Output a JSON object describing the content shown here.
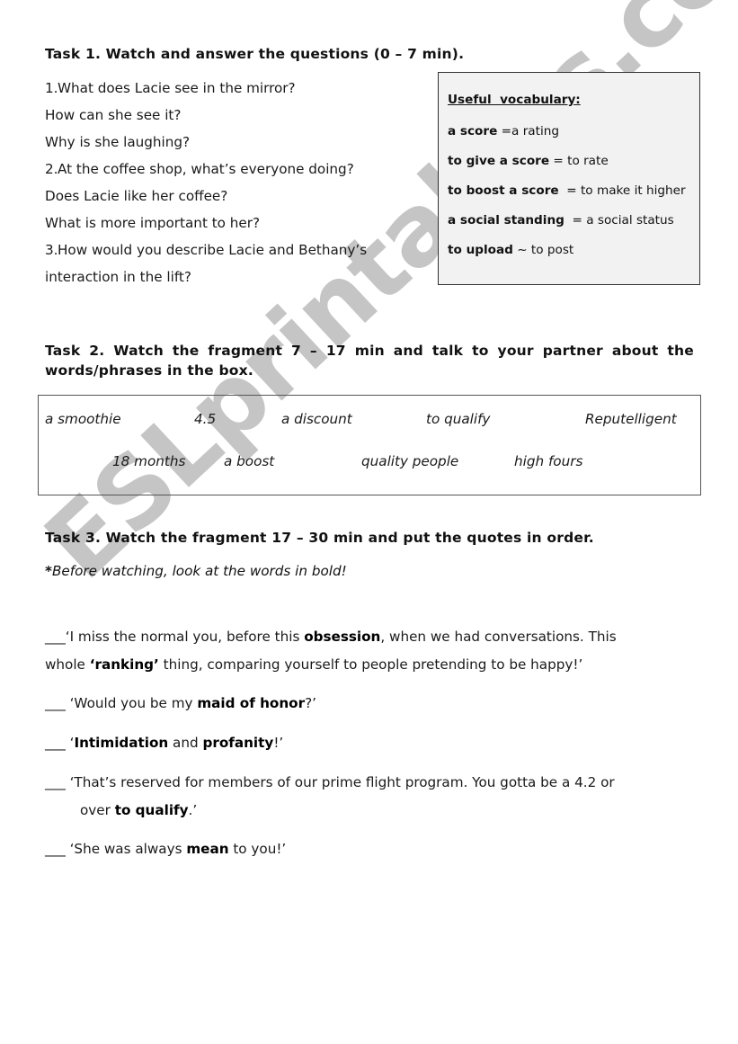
{
  "task1": {
    "title": "Task 1. Watch and answer the questions (0 – 7 min).",
    "questions": [
      {
        "num": "1.",
        "text": "What does Lacie see in the mirror?"
      },
      {
        "num": "",
        "text": "How can she see it?"
      },
      {
        "num": "",
        "text": "Why is she laughing?"
      },
      {
        "num": "2.",
        "text": "At the coffee shop, what’s everyone doing?"
      },
      {
        "num": "",
        "text": "Does Lacie like her coffee?"
      },
      {
        "num": "",
        "text": "What is more important to her?"
      },
      {
        "num": "3.",
        "text": "How would you describe Lacie and Bethany’s"
      },
      {
        "num": "",
        "text": "interaction in the lift?"
      }
    ]
  },
  "vocabulary": {
    "title": "Useful  vocabulary:",
    "items": [
      {
        "term": "a score",
        "definition": " =a rating"
      },
      {
        "term": "to give a score",
        "definition": " = to rate"
      },
      {
        "term": "to boost a score",
        "definition": "  = to make it higher"
      },
      {
        "term": "a social standing",
        "definition": "  = a social status"
      },
      {
        "term": "to upload",
        "definition": " ~ to post"
      }
    ]
  },
  "task2": {
    "title_line1": "Task 2. Watch the fragment 7 – 17 min and talk to your partner about the",
    "title_line2": "words/phrases in the box.",
    "words_row1": [
      "a smoothie",
      "4.5",
      "a discount",
      "to qualify",
      "Reputelligent"
    ],
    "words_row2": [
      "18 months",
      "a boost",
      "quality people",
      "high fours"
    ]
  },
  "task3": {
    "title": "Task 3. Watch the fragment 17 – 30 min and put the quotes in order.",
    "instruction_star": "*",
    "instruction": "Before watching, look at the words in bold!",
    "blank": "___",
    "quotes": [
      {
        "line1": [
          {
            "t": "‘I miss the normal you, before this ",
            "b": false
          },
          {
            "t": "obsession",
            "b": true
          },
          {
            "t": ", when we had conversations. This",
            "b": false
          }
        ],
        "line2": [
          {
            "t": "whole ",
            "b": false
          },
          {
            "t": "‘ranking’",
            "b": true
          },
          {
            "t": " thing, comparing yourself to people pretending to be happy!’",
            "b": false
          }
        ]
      },
      {
        "line1": [
          {
            "t": " ‘Would you be my ",
            "b": false
          },
          {
            "t": "maid of honor",
            "b": true
          },
          {
            "t": "?’",
            "b": false
          }
        ]
      },
      {
        "line1": [
          {
            "t": " ‘",
            "b": false
          },
          {
            "t": "Intimidation",
            "b": true
          },
          {
            "t": " and ",
            "b": false
          },
          {
            "t": "profanity",
            "b": true
          },
          {
            "t": "!’",
            "b": false
          }
        ]
      },
      {
        "line1": [
          {
            "t": " ‘That’s reserved for members of our prime flight program. You gotta be a 4.2 or",
            "b": false
          }
        ],
        "line2": [
          {
            "t": "over ",
            "b": false
          },
          {
            "t": "to qualify",
            "b": true
          },
          {
            "t": ".’",
            "b": false
          }
        ]
      },
      {
        "line1": [
          {
            "t": " ‘She was always ",
            "b": false
          },
          {
            "t": "mean",
            "b": true
          },
          {
            "t": " to you!’",
            "b": false
          }
        ]
      }
    ]
  },
  "watermark": "ESLprintables.com"
}
